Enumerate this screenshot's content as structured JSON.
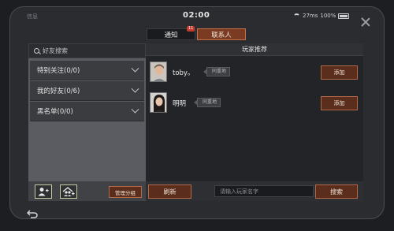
{
  "status": {
    "left_text": "信息",
    "time": "02:00",
    "ping": "27ms",
    "battery": "100%"
  },
  "tabs": [
    {
      "label": "通知",
      "badge": "11"
    },
    {
      "label": "联系人"
    }
  ],
  "search": {
    "placeholder": "好友搜索"
  },
  "groups": [
    {
      "label": "特别关注(0/0)"
    },
    {
      "label": "我的好友(0/6)"
    },
    {
      "label": "黑名单(0/0)"
    }
  ],
  "left_footer": {
    "manage_label": "管理分组"
  },
  "recommend": {
    "title": "玩家推荐",
    "players": [
      {
        "name": "toby。",
        "tag": "同重地",
        "add_label": "添加"
      },
      {
        "name": "明明",
        "tag": "同重地",
        "add_label": "添加"
      }
    ]
  },
  "right_footer": {
    "refresh_label": "刷新",
    "input_placeholder": "请输入玩家名字",
    "search_label": "搜索"
  },
  "colors": {
    "accent": "#5a2d1c",
    "accent_border": "#b06a47",
    "panel": "#222427"
  }
}
